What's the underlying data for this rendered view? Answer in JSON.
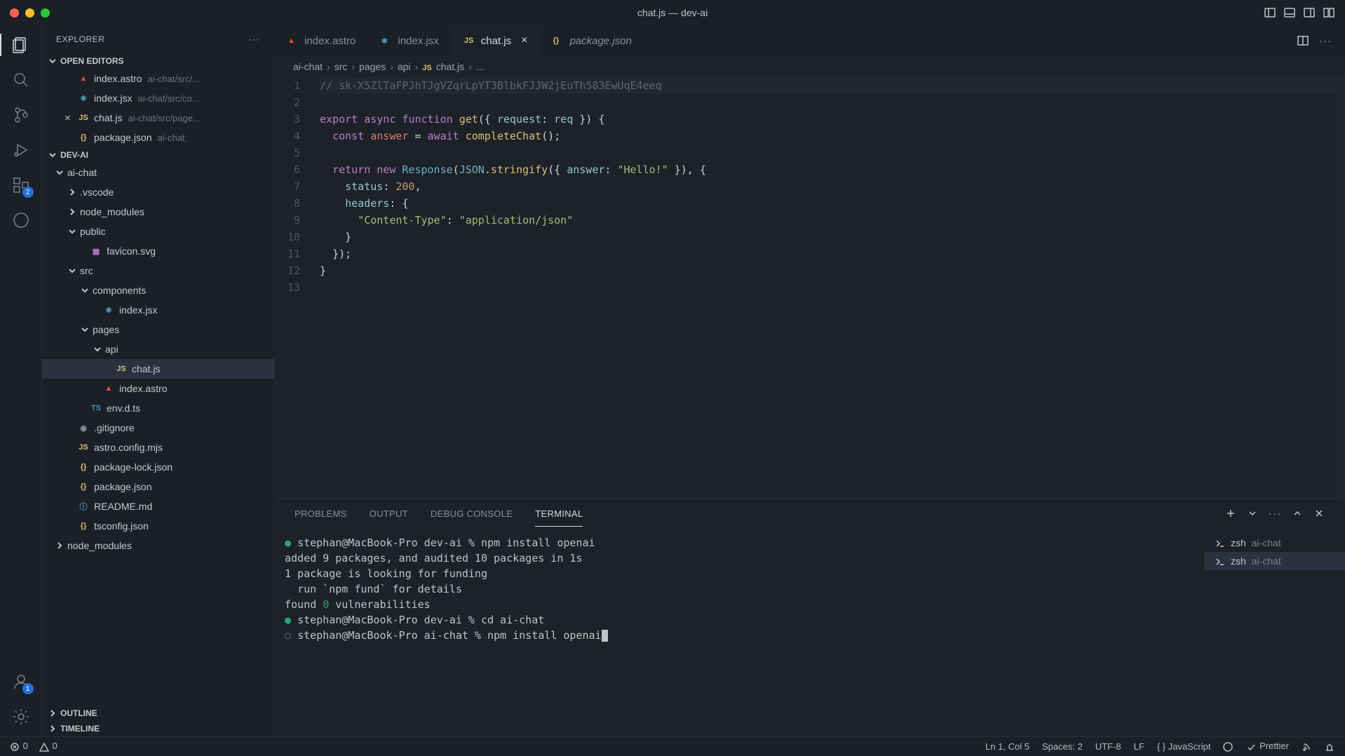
{
  "title": "chat.js — dev-ai",
  "explorer": {
    "label": "EXPLORER"
  },
  "sections": {
    "openEditors": "OPEN EDITORS",
    "project": "DEV-AI",
    "outline": "OUTLINE",
    "timeline": "TIMELINE"
  },
  "openEditors": [
    {
      "icon": "astro",
      "name": "index.astro",
      "path": "ai-chat/src/..."
    },
    {
      "icon": "react",
      "name": "index.jsx",
      "path": "ai-chat/src/co..."
    },
    {
      "icon": "js",
      "name": "chat.js",
      "path": "ai-chat/src/page...",
      "closable": true
    },
    {
      "icon": "json",
      "name": "package.json",
      "path": "ai-chat"
    }
  ],
  "tree": [
    {
      "d": 0,
      "t": "folder",
      "open": true,
      "name": "ai-chat"
    },
    {
      "d": 1,
      "t": "folder",
      "open": false,
      "name": ".vscode"
    },
    {
      "d": 1,
      "t": "folder",
      "open": false,
      "name": "node_modules"
    },
    {
      "d": 1,
      "t": "folder",
      "open": true,
      "name": "public"
    },
    {
      "d": 2,
      "t": "file",
      "icon": "svg",
      "name": "favicon.svg"
    },
    {
      "d": 1,
      "t": "folder",
      "open": true,
      "name": "src"
    },
    {
      "d": 2,
      "t": "folder",
      "open": true,
      "name": "components"
    },
    {
      "d": 3,
      "t": "file",
      "icon": "react",
      "name": "index.jsx"
    },
    {
      "d": 2,
      "t": "folder",
      "open": true,
      "name": "pages"
    },
    {
      "d": 3,
      "t": "folder",
      "open": true,
      "name": "api"
    },
    {
      "d": 4,
      "t": "file",
      "icon": "js",
      "name": "chat.js",
      "sel": true
    },
    {
      "d": 3,
      "t": "file",
      "icon": "astro",
      "name": "index.astro"
    },
    {
      "d": 2,
      "t": "file",
      "icon": "ts",
      "name": "env.d.ts"
    },
    {
      "d": 1,
      "t": "file",
      "icon": "git",
      "name": ".gitignore"
    },
    {
      "d": 1,
      "t": "file",
      "icon": "js",
      "name": "astro.config.mjs"
    },
    {
      "d": 1,
      "t": "file",
      "icon": "json",
      "name": "package-lock.json"
    },
    {
      "d": 1,
      "t": "file",
      "icon": "json",
      "name": "package.json"
    },
    {
      "d": 1,
      "t": "file",
      "icon": "info",
      "name": "README.md"
    },
    {
      "d": 1,
      "t": "file",
      "icon": "json",
      "name": "tsconfig.json"
    },
    {
      "d": 0,
      "t": "folder",
      "open": false,
      "name": "node_modules"
    }
  ],
  "tabs": [
    {
      "icon": "astro",
      "name": "index.astro"
    },
    {
      "icon": "react",
      "name": "index.jsx"
    },
    {
      "icon": "js",
      "name": "chat.js",
      "active": true,
      "close": true
    },
    {
      "icon": "json",
      "name": "package.json",
      "italic": true
    }
  ],
  "breadcrumb": [
    "ai-chat",
    "src",
    "pages",
    "api",
    "chat.js",
    "..."
  ],
  "breadcrumbIcon": "js",
  "code": {
    "1": "// 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",
    "3a": "export",
    "3b": "async",
    "3c": "function",
    "3d": "get",
    "3e": "request",
    "3f": "req",
    "4a": "const",
    "4b": "answer",
    "4c": "await",
    "4d": "completeChat",
    "6a": "return",
    "6b": "new",
    "6c": "Response",
    "6d": "JSON",
    "6e": "stringify",
    "6f": "answer",
    "6g": "\"Hello!\"",
    "7a": "status",
    "7b": "200",
    "8a": "headers",
    "9a": "\"Content-Type\"",
    "9b": "\"application/json\""
  },
  "panel": {
    "tabs": [
      "PROBLEMS",
      "OUTPUT",
      "DEBUG CONSOLE",
      "TERMINAL"
    ],
    "active": 3
  },
  "terminal": {
    "lines": [
      {
        "dot": "g",
        "text": "stephan@MacBook-Pro dev-ai % npm install openai"
      },
      {
        "text": ""
      },
      {
        "text": "added 9 packages, and audited 10 packages in 1s"
      },
      {
        "text": ""
      },
      {
        "text": "1 package is looking for funding"
      },
      {
        "text": "  run `npm fund` for details"
      },
      {
        "text": ""
      },
      {
        "text": "found ",
        "green": "0",
        "text2": " vulnerabilities"
      },
      {
        "dot": "g",
        "text": "stephan@MacBook-Pro dev-ai % cd ai-chat"
      },
      {
        "dot": "d",
        "text": "stephan@MacBook-Pro ai-chat % npm install openai",
        "cursor": true
      }
    ],
    "sessions": [
      {
        "shell": "zsh",
        "dir": "ai-chat"
      },
      {
        "shell": "zsh",
        "dir": "ai-chat",
        "active": true
      }
    ]
  },
  "status": {
    "errors": "0",
    "warnings": "0",
    "cursor": "Ln 1, Col 5",
    "spaces": "Spaces: 2",
    "enc": "UTF-8",
    "eol": "LF",
    "lang": "JavaScript",
    "prettier": "Prettier"
  },
  "activityBadges": {
    "ext": "2",
    "acc": "1"
  }
}
